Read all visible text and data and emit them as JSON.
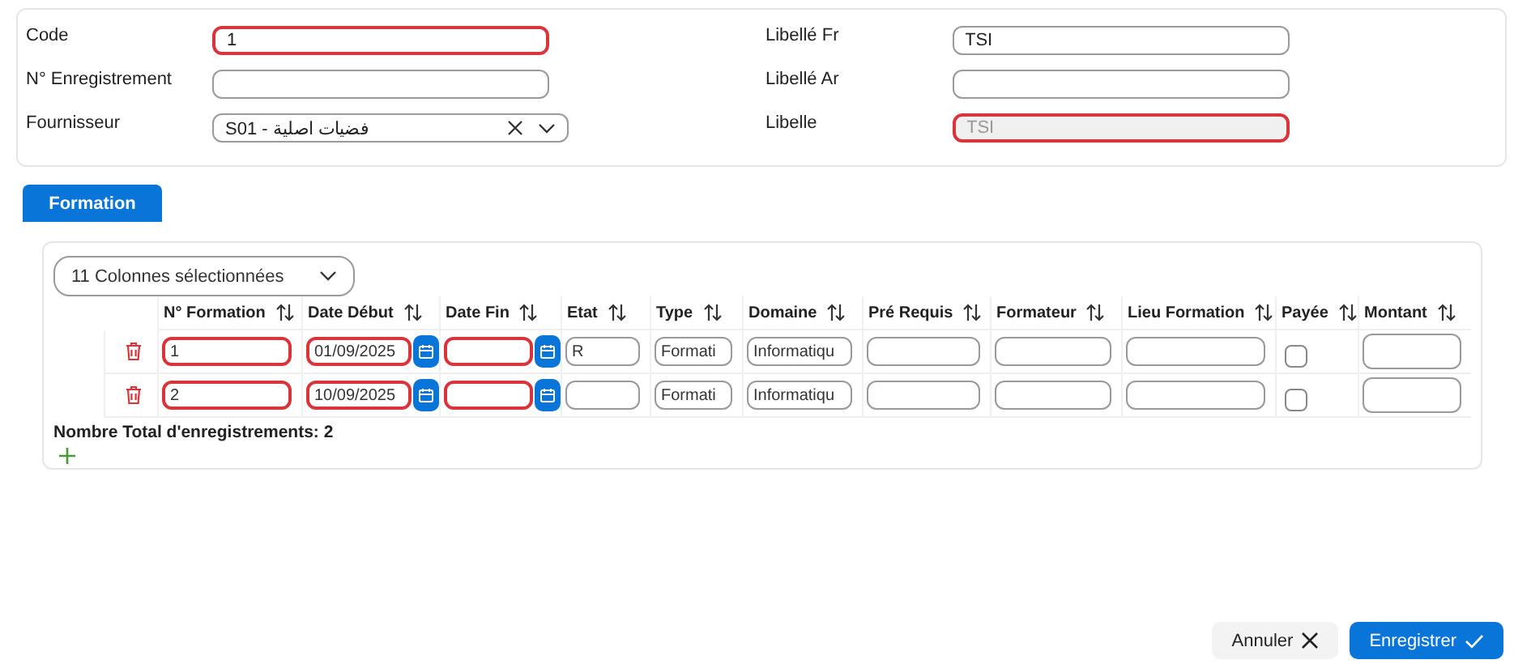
{
  "form": {
    "left": [
      {
        "label": "Code",
        "kind": "text",
        "value": "1",
        "invalid": true,
        "disabled": false
      },
      {
        "label": "N° Enregistrement",
        "kind": "text",
        "invalid": false,
        "disabled": false
      },
      {
        "label": "Fournisseur",
        "kind": "select",
        "value": "S01 - فضيات اصلية",
        "invalid": false,
        "disabled": false
      }
    ],
    "right": [
      {
        "label": "Libellé Fr",
        "kind": "text",
        "value": "TSI",
        "invalid": false,
        "disabled": false
      },
      {
        "label": "Libellé Ar",
        "kind": "text",
        "invalid": false,
        "disabled": false
      },
      {
        "label": "Libelle",
        "kind": "text",
        "value": "TSI",
        "invalid": true,
        "disabled": true
      }
    ]
  },
  "tabs": [
    {
      "label": "Formation",
      "selected": true
    }
  ],
  "grid": {
    "column_picker": "11 Colonnes sélectionnées",
    "columns": [
      "N° Formation",
      "Date Début",
      "Date Fin",
      "Etat",
      "Type",
      "Domaine",
      "Pré Requis",
      "Formateur",
      "Lieu Formation",
      "Payée",
      "Montant"
    ],
    "rows": [
      {
        "cells": [
          {
            "kind": "text",
            "value": "1",
            "invalid": true
          },
          {
            "kind": "date",
            "value": "01/09/2025",
            "invalid": true
          },
          {
            "kind": "date",
            "invalid": true
          },
          {
            "kind": "text",
            "value": "R",
            "invalid": false
          },
          {
            "kind": "text",
            "value": "Formati",
            "invalid": false
          },
          {
            "kind": "text",
            "value": "Informatiqu",
            "invalid": false
          },
          {
            "kind": "text",
            "invalid": false
          },
          {
            "kind": "text",
            "invalid": false
          },
          {
            "kind": "text",
            "invalid": false
          },
          {
            "kind": "checkbox",
            "checked": false
          },
          {
            "kind": "amount",
            "invalid": false
          }
        ]
      },
      {
        "cells": [
          {
            "kind": "text",
            "value": "2",
            "invalid": true
          },
          {
            "kind": "date",
            "value": "10/09/2025",
            "invalid": true
          },
          {
            "kind": "date",
            "invalid": true
          },
          {
            "kind": "text",
            "invalid": false
          },
          {
            "kind": "text",
            "value": "Formati",
            "invalid": false
          },
          {
            "kind": "text",
            "value": "Informatiqu",
            "invalid": false
          },
          {
            "kind": "text",
            "invalid": false
          },
          {
            "kind": "text",
            "invalid": false
          },
          {
            "kind": "text",
            "invalid": false
          },
          {
            "kind": "checkbox",
            "checked": false
          },
          {
            "kind": "amount",
            "invalid": false
          }
        ]
      }
    ],
    "total": "Nombre Total d'enregistrements: 2"
  },
  "buttons": [
    {
      "label": "Annuler",
      "kind": "cancel"
    },
    {
      "label": "Enregistrer",
      "kind": "save"
    }
  ]
}
